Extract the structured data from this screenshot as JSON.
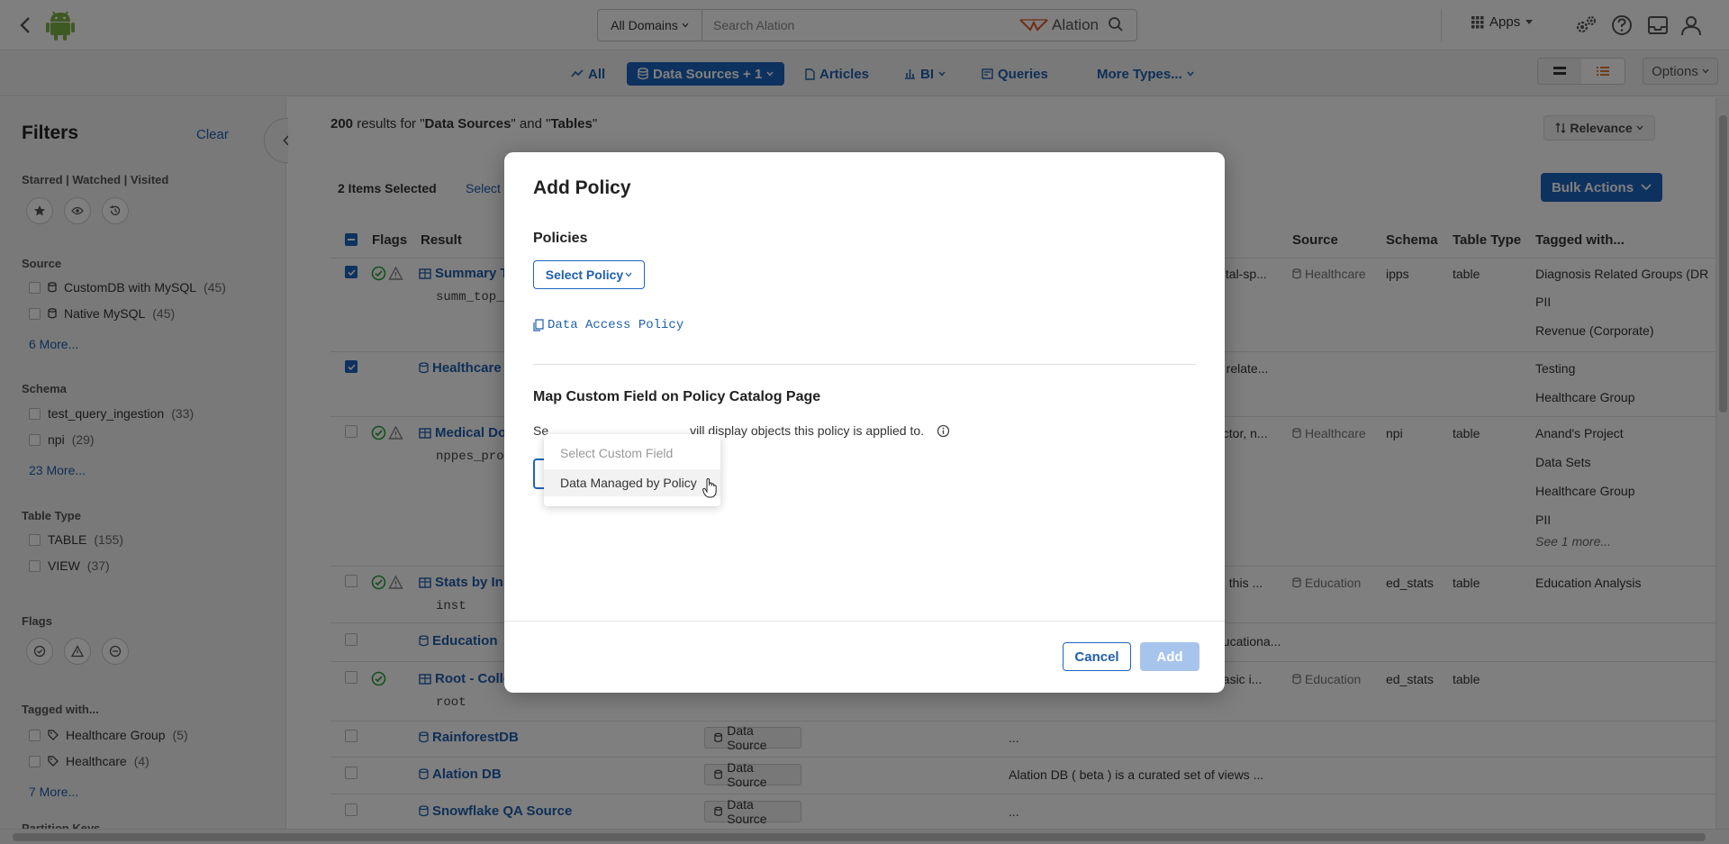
{
  "topbar": {
    "domain_select": "All Domains",
    "search_placeholder": "Search Alation",
    "brand": "Alation",
    "apps_label": "Apps"
  },
  "typebar": {
    "items": [
      "All",
      "Data Sources + 1",
      "Articles",
      "BI",
      "Queries",
      "More Types..."
    ],
    "options_label": "Options"
  },
  "filters": {
    "title": "Filters",
    "clear": "Clear",
    "starred_section": "Starred | Watched | Visited",
    "source_section": "Source",
    "source_items": [
      {
        "label": "CustomDB with MySQL",
        "count": "(45)"
      },
      {
        "label": "Native MySQL",
        "count": "(45)"
      }
    ],
    "source_more": "6 More...",
    "schema_section": "Schema",
    "schema_items": [
      {
        "label": "test_query_ingestion",
        "count": "(33)"
      },
      {
        "label": "npi",
        "count": "(29)"
      }
    ],
    "schema_more": "23 More...",
    "tabletype_section": "Table Type",
    "tabletype_items": [
      {
        "label": "TABLE",
        "count": "(155)"
      },
      {
        "label": "VIEW",
        "count": "(37)"
      }
    ],
    "flags_section": "Flags",
    "tagged_section": "Tagged with...",
    "tagged_items": [
      {
        "label": "Healthcare Group",
        "count": "(5)"
      },
      {
        "label": "Healthcare",
        "count": "(4)"
      }
    ],
    "tagged_more": "7 More...",
    "partition_section": "Partition Keys"
  },
  "results": {
    "count": "200",
    "text_mid": " results for \"",
    "q1": "Data Sources",
    "text_and": "\" and \"",
    "q2": "Tables",
    "text_end": "\"",
    "relevance": "Relevance",
    "items_selected": "2 Items Selected",
    "select_link": "Select",
    "bulk_actions": "Bulk Actions",
    "columns": {
      "flags": "Flags",
      "result": "Result",
      "source": "Source",
      "schema": "Schema",
      "table_type": "Table Type",
      "tagged": "Tagged with..."
    },
    "rows": [
      {
        "title": "Summary T",
        "sub": "summ_top_",
        "desc": "pital-sp...",
        "source": "Healthcare",
        "schema": "ipps",
        "type": "table",
        "tags": [
          "Diagnosis Related Groups (DR",
          "PII",
          "Revenue (Corporate)"
        ]
      },
      {
        "title": "Healthcare",
        "desc": "a relate...",
        "tags": [
          "Testing",
          "Healthcare Group"
        ]
      },
      {
        "title": "Medical Do",
        "sub": "nppes_pro",
        "desc": "octor, n...",
        "source": "Healthcare",
        "schema": "npi",
        "type": "table",
        "tags": [
          "Anand's Project",
          "Data Sets",
          "Healthcare Group",
          "PII"
        ],
        "see_more": "See 1 more..."
      },
      {
        "title": "Stats by Ins",
        "sub": "inst",
        "desc": "in this ...",
        "source": "Education",
        "schema": "ed_stats",
        "type": "table",
        "tags": [
          "Education Analysis"
        ]
      },
      {
        "title": "Education",
        "desc": "ducationa..."
      },
      {
        "title": "Root - Colle",
        "sub": "root",
        "desc": "basic i...",
        "source": "Education",
        "schema": "ed_stats",
        "type": "table"
      },
      {
        "title": "RainforestDB",
        "badge": "Data Source",
        "desc": "..."
      },
      {
        "title": "Alation DB",
        "badge": "Data Source",
        "desc": "Alation DB ( beta ) is a curated set of views ..."
      },
      {
        "title": "Snowflake QA Source",
        "badge": "Data Source",
        "desc": "..."
      }
    ]
  },
  "modal": {
    "title": "Add Policy",
    "policies_section": "Policies",
    "select_policy": "Select Policy",
    "policy_link": "Data Access Policy",
    "map_section": "Map Custom Field on Policy Catalog Page",
    "desc_start": "Se",
    "desc_end": "vill display objects this policy is applied to.",
    "dropdown_placeholder": "Select Custom Field",
    "dropdown_option": "Data Managed by Policy",
    "cancel": "Cancel",
    "add": "Add"
  },
  "colors": {
    "accent": "#1d64bf",
    "success": "#2e9e3e"
  }
}
